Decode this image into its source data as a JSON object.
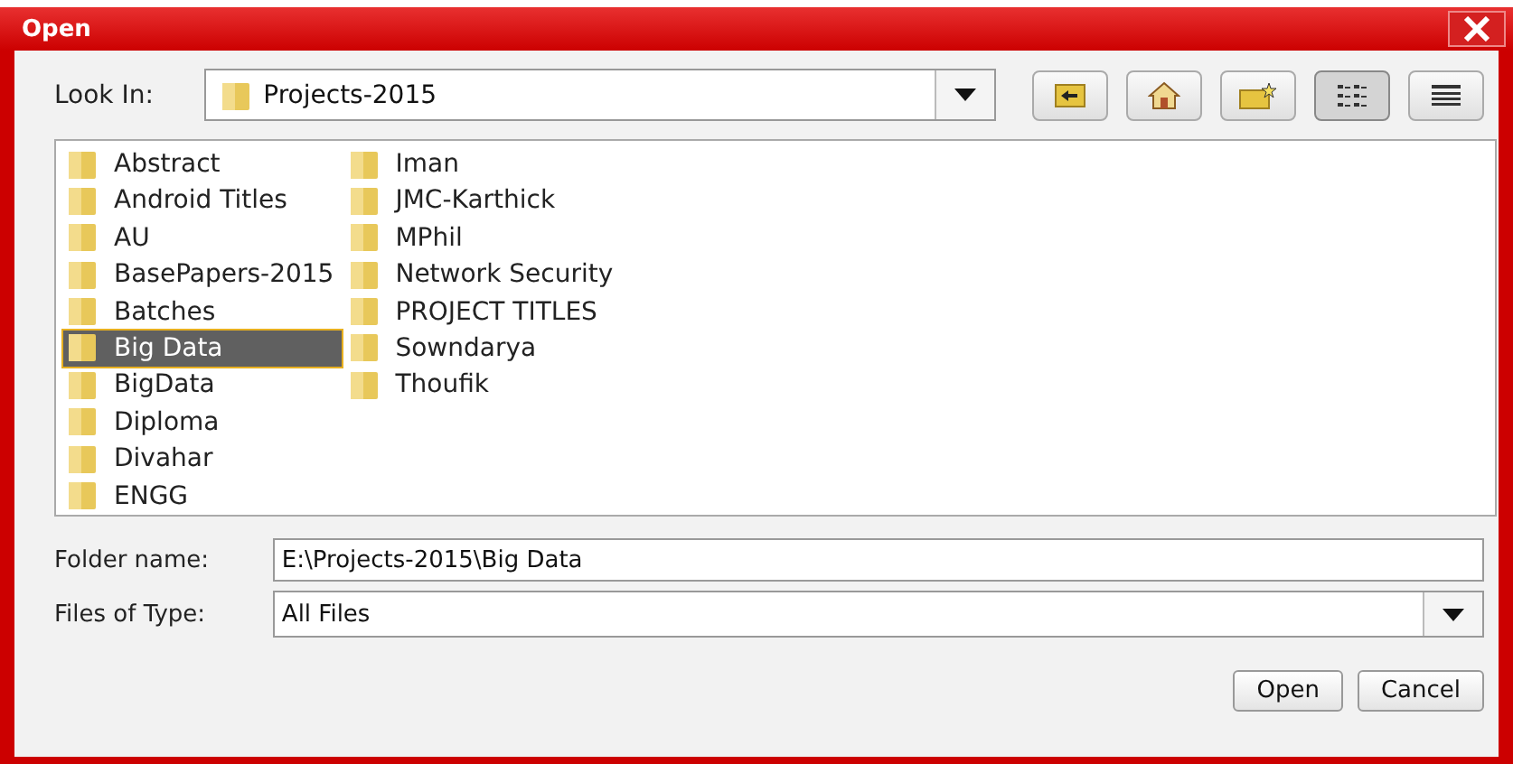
{
  "window": {
    "title": "Open"
  },
  "look_in": {
    "label": "Look In:",
    "value": "Projects-2015"
  },
  "toolbar": [
    {
      "kind": "up",
      "selected": false
    },
    {
      "kind": "home",
      "selected": false
    },
    {
      "kind": "newfolder",
      "selected": false
    },
    {
      "kind": "list",
      "selected": true
    },
    {
      "kind": "details",
      "selected": false
    }
  ],
  "files": [
    {
      "name": "Abstract",
      "selected": false
    },
    {
      "name": "Android Titles",
      "selected": false
    },
    {
      "name": "AU",
      "selected": false
    },
    {
      "name": "BasePapers-2015",
      "selected": false
    },
    {
      "name": "Batches",
      "selected": false
    },
    {
      "name": "Big Data",
      "selected": true
    },
    {
      "name": "BigData",
      "selected": false
    },
    {
      "name": "Diploma",
      "selected": false
    },
    {
      "name": "Divahar",
      "selected": false
    },
    {
      "name": "ENGG",
      "selected": false
    },
    {
      "name": "Iman",
      "selected": false
    },
    {
      "name": "JMC-Karthick",
      "selected": false
    },
    {
      "name": "MPhil",
      "selected": false
    },
    {
      "name": "Network Security",
      "selected": false
    },
    {
      "name": "PROJECT TITLES",
      "selected": false
    },
    {
      "name": "Sowndarya",
      "selected": false
    },
    {
      "name": "Thoufik",
      "selected": false
    }
  ],
  "folder_name": {
    "label": "Folder name:",
    "value": "E:\\Projects-2015\\Big Data"
  },
  "files_of_type": {
    "label": "Files of Type:",
    "value": "All Files"
  },
  "buttons": [
    "Open",
    "Cancel"
  ]
}
